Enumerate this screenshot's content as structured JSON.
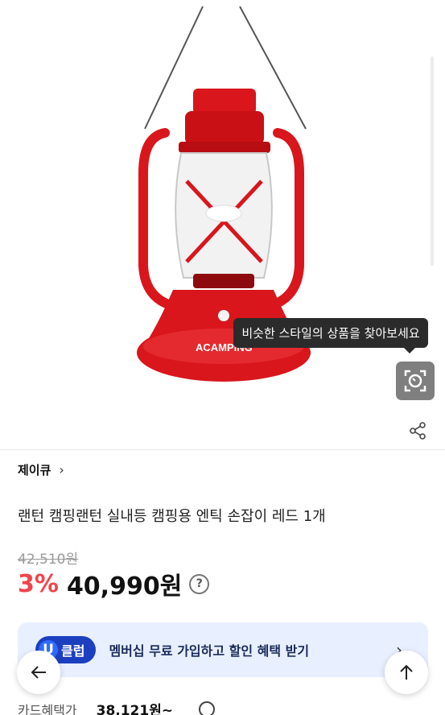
{
  "tooltip": {
    "text": "비슷한 스타일의 상품을 찾아보세요"
  },
  "icons": {
    "lens": "camera-search-icon",
    "share": "share-icon",
    "back": "arrow-left-icon",
    "top": "arrow-up-icon",
    "brand_chevron": "chevron-right-icon",
    "info": "question-circle-icon"
  },
  "product": {
    "brand": "제이큐",
    "brand_chevron": "›",
    "title": "랜턴 캠핑랜턴 실내등 캠핑용 엔틱 손잡이 레드 1개",
    "original_price": "42,510원",
    "discount": "3%",
    "price": "40,990원",
    "info_icon": "?",
    "lantern_logo": "ACAMPING"
  },
  "membership": {
    "badge_u": "U",
    "badge_text": "클럽",
    "text": "멤버십 무료 가입하고 할인 혜택 받기",
    "arrow": "›"
  },
  "card": {
    "label": "카드혜택가",
    "price": "38,121원~"
  },
  "colors": {
    "accent_red": "#f0444a",
    "membership_bg": "#e8efff",
    "badge_blue": "#1c3fbf",
    "lantern_red": "#d8161c"
  }
}
